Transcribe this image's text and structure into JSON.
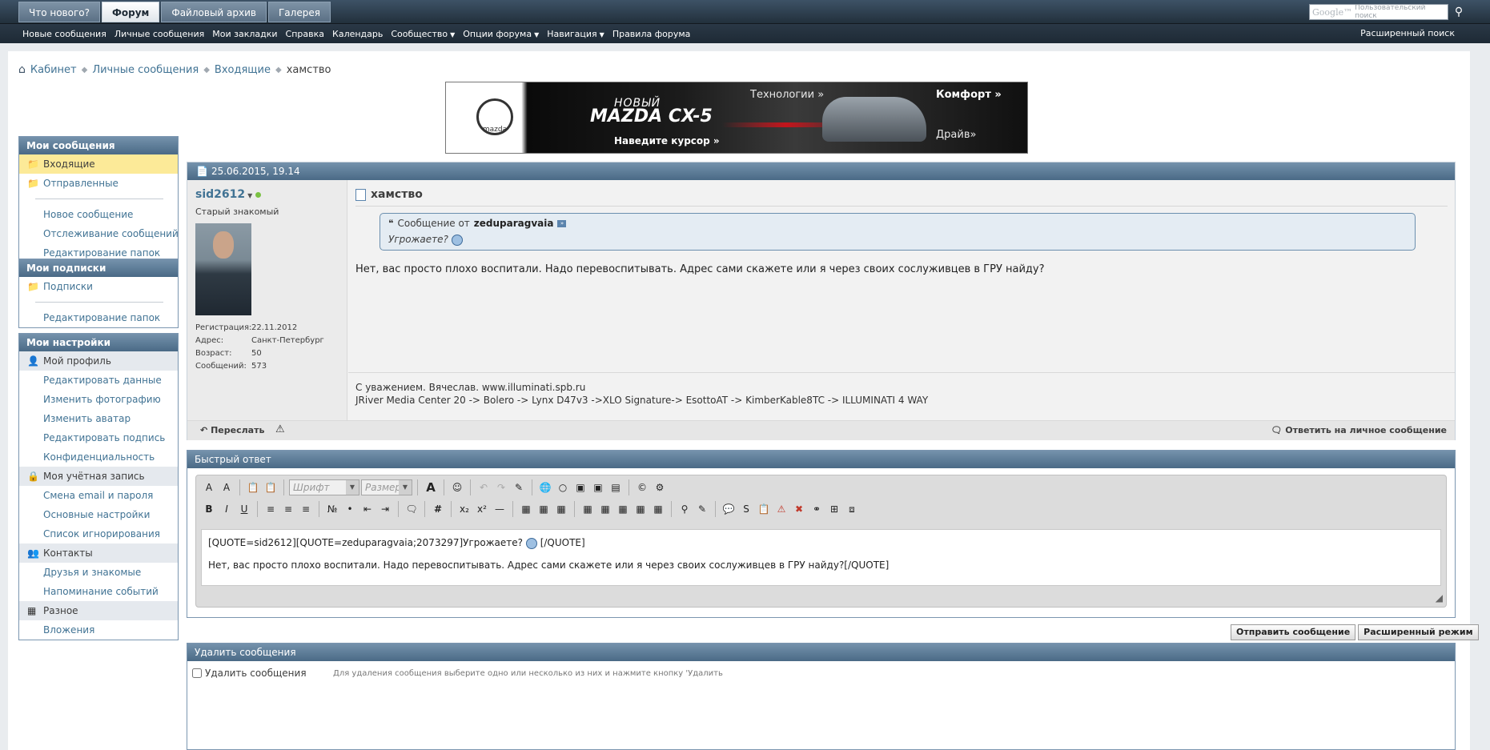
{
  "topbar": {
    "tabs": [
      "Что нового?",
      "Форум",
      "Файловый архив",
      "Галерея"
    ],
    "search_brand": "Google™",
    "search_placeholder": "Пользовательский поиск"
  },
  "navbar": {
    "links": [
      "Новые сообщения",
      "Личные сообщения",
      "Мои закладки",
      "Справка",
      "Календарь",
      "Сообщество",
      "Опции форума",
      "Навигация",
      "Правила форума"
    ],
    "advanced_search": "Расширенный поиск"
  },
  "breadcrumb": {
    "items": [
      "Кабинет",
      "Личные сообщения",
      "Входящие"
    ],
    "current": "хамство"
  },
  "banner": {
    "brand": "mazda",
    "new_label": "НОВЫЙ",
    "model": "MAZDA CX-5",
    "cta": "Наведите курсор »",
    "tech": "Технологии »",
    "comfort": "Комфорт »",
    "drive": "Драйв»"
  },
  "sidebar": {
    "my_messages": {
      "title": "Мои сообщения",
      "folders": [
        "Входящие",
        "Отправленные"
      ],
      "links": [
        "Новое сообщение",
        "Отслеживание сообщений",
        "Редактирование папок"
      ]
    },
    "my_subscriptions": {
      "title": "Мои подписки",
      "folders": [
        "Подписки"
      ],
      "links": [
        "Редактирование папок"
      ]
    },
    "my_settings": {
      "title": "Мои настройки",
      "profile": "Мой профиль",
      "profile_links": [
        "Редактировать данные",
        "Изменить фотографию",
        "Изменить аватар",
        "Редактировать подпись",
        "Конфиденциальность"
      ],
      "account": "Моя учётная запись",
      "account_links": [
        "Смена email и пароля",
        "Основные настройки",
        "Список игнорирования"
      ],
      "contacts": "Контакты",
      "contacts_links": [
        "Друзья и знакомые",
        "Напоминание событий"
      ],
      "misc": "Разное",
      "misc_links": [
        "Вложения"
      ]
    }
  },
  "post": {
    "date": "25.06.2015, 19.14",
    "username": "sid2612",
    "usertitle": "Старый знакомый",
    "info": [
      {
        "k": "Регистрация:",
        "v": "22.11.2012"
      },
      {
        "k": "Адрес:",
        "v": "Санкт-Петербург"
      },
      {
        "k": "Возраст:",
        "v": "50"
      },
      {
        "k": "Сообщений:",
        "v": "573"
      }
    ],
    "title": "хамство",
    "quote_prefix": "Сообщение от",
    "quote_author": "zeduparagvaia",
    "quote_text": "Угрожаете?",
    "message": "Нет, вас просто плохо воспитали. Надо перевоспитывать. Адрес сами скажете или я через своих сослуживцев в ГРУ найду?",
    "signature_1": "С уважением. Вячеслав. www.illuminati.spb.ru",
    "signature_2": "JRiver Media Center 20 -> Bolero -> Lynx D47v3 ->XLO Signature-> EsottoAT -> KimberKable8TC -> ILLUMINATI 4 WAY",
    "forward": "Переслать",
    "reply_pm": "Ответить на личное сообщение"
  },
  "quick_reply": {
    "title": "Быстрый ответ",
    "font_select": "Шрифт",
    "size_select": "Размер",
    "line1": "[QUOTE=sid2612][QUOTE=zeduparagvaia;2073297]Угрожаете?",
    "line1_end": "[/QUOTE]",
    "line2": "Нет, вас просто плохо воспитали. Надо перевоспитывать. Адрес сами скажете или я через своих сослуживцев в ГРУ найду?[/QUOTE]",
    "send": "Отправить сообщение",
    "advanced": "Расширенный режим"
  },
  "delete": {
    "title": "Удалить сообщения",
    "checkbox": "Удалить сообщения",
    "hint": "Для удаления сообщения выберите одно или несколько из них и нажмите кнопку 'Удалить"
  },
  "colors": {
    "header_blue": "#5b7a96",
    "link": "#417394",
    "highlight": "#fcea98"
  }
}
